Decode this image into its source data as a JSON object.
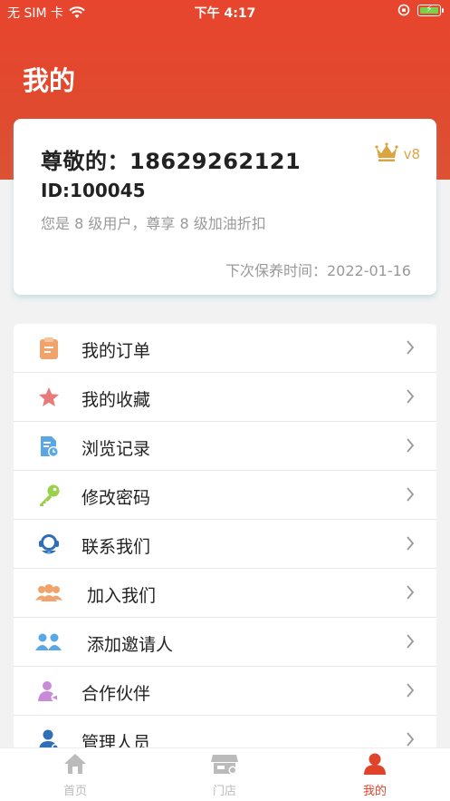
{
  "status_bar": {
    "carrier": "无 SIM 卡",
    "time": "下午 4:17"
  },
  "header": {
    "title": "我的"
  },
  "profile": {
    "greeting": "尊敬的：18629262121",
    "id": "ID:100045",
    "level_desc": "您是 8 级用户，尊享 8 级加油折扣",
    "vip_label": "v8",
    "maintenance": "下次保养时间：2022-01-16"
  },
  "menu": {
    "items": [
      {
        "label": "我的订单",
        "icon": "clipboard-icon",
        "color": "#f0a36b"
      },
      {
        "label": "我的收藏",
        "icon": "star-icon",
        "color": "#e87a7a"
      },
      {
        "label": "浏览记录",
        "icon": "history-doc-icon",
        "color": "#5aa7e6"
      },
      {
        "label": "修改密码",
        "icon": "key-icon",
        "color": "#9bd04a"
      },
      {
        "label": "联系我们",
        "icon": "support-agent-icon",
        "color": "#2e6fb8"
      },
      {
        "label": "加入我们",
        "icon": "group-icon",
        "color": "#f0a36b"
      },
      {
        "label": "添加邀请人",
        "icon": "invite-group-icon",
        "color": "#5aa7e6"
      },
      {
        "label": "合作伙伴",
        "icon": "partner-icon",
        "color": "#c88bd8"
      },
      {
        "label": "管理人员",
        "icon": "admin-icon",
        "color": "#2e6fb8"
      }
    ]
  },
  "tabbar": {
    "tabs": [
      {
        "label": "首页",
        "icon": "home-icon"
      },
      {
        "label": "门店",
        "icon": "store-icon"
      },
      {
        "label": "我的",
        "icon": "profile-icon"
      }
    ],
    "active_color": "#e0432b"
  }
}
